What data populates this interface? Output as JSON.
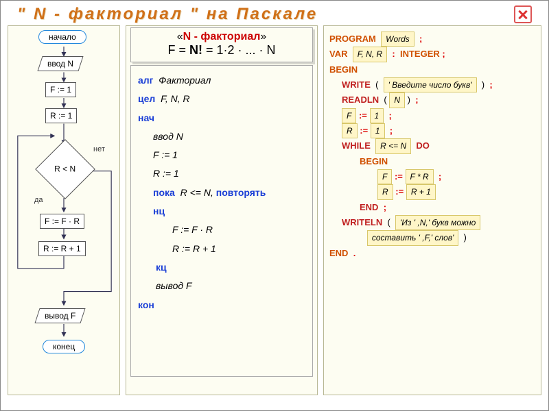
{
  "title": "\" N - факториал \"   на   Паскале",
  "close_label": "close",
  "headbox": {
    "before": "«",
    "nword": "N - факториал",
    "after": "»",
    "formula_pre": "F = ",
    "formula_bold": "N!",
    "formula_rest": " = 1·2 · ... · N"
  },
  "flow": {
    "begin": "начало",
    "input": "ввод N",
    "f1": "F := 1",
    "r1": "R := 1",
    "cond": "R < N",
    "yes": "да",
    "no": "нет",
    "body1": "F := F · R",
    "body2": "R := R + 1",
    "output": "вывод F",
    "end": "конец"
  },
  "algo": {
    "l1a": "алг",
    "l1b": "Факториал",
    "l2a": "цел",
    "l2b": "F, N, R",
    "l3": "нач",
    "l4": "ввод  N",
    "l5": "F := 1",
    "l6": "R := 1",
    "l7a": "пока",
    "l7b": "R <= N,",
    "l7c": "повторять",
    "l8": "нц",
    "l9": "F := F · R",
    "l10": "R := R + 1",
    "l11": "кц",
    "l12": "вывод  F",
    "l13": "кон"
  },
  "pascal": {
    "program": "PROGRAM",
    "program_name": "Words",
    "var": "VAR",
    "vars": "F, N, R",
    "integer": "INTEGER",
    "begin": "BEGIN",
    "write": "WRITE",
    "write_arg": "' Введите число букв'",
    "readln": "READLN",
    "readln_arg": "N",
    "f": "F",
    "one": "1",
    "r": "R",
    "while": "WHILE",
    "while_cond": "R <= N",
    "do": "DO",
    "body_f_expr": "F * R",
    "body_r_expr": "R + 1",
    "end_inner": "END",
    "writeln": "WRITELN",
    "writeln_arg1": "'Из ' ,N,' букв можно",
    "writeln_arg2": "составить ' ,F,' слов'",
    "end": "END",
    "assign": ":="
  }
}
